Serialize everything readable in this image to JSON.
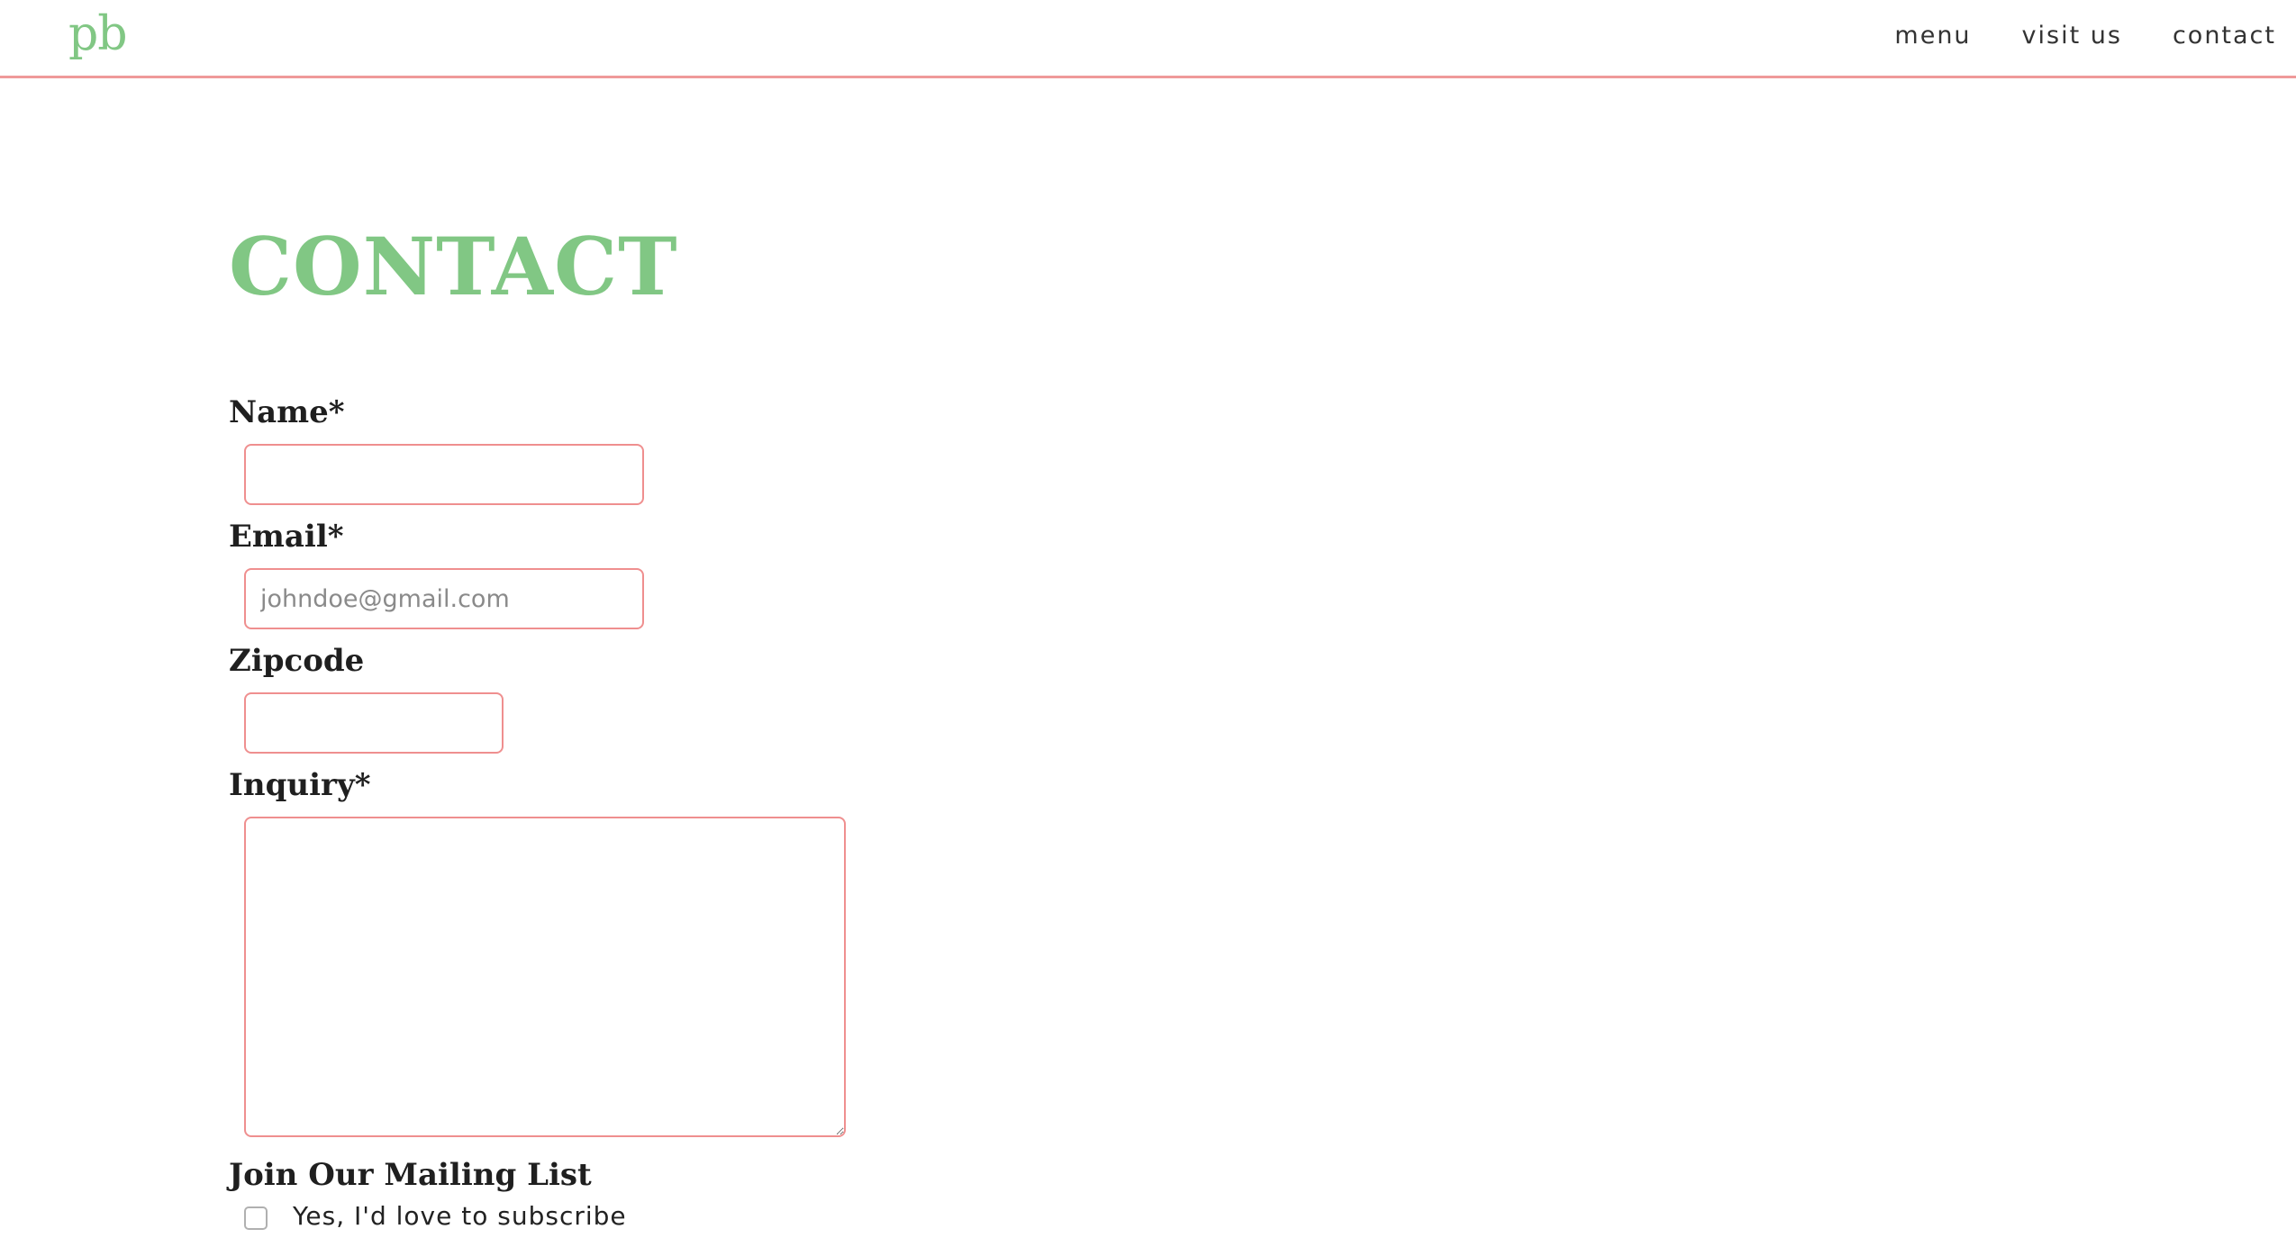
{
  "nav": {
    "logo": "pb",
    "links": [
      {
        "label": "menu"
      },
      {
        "label": "visit us"
      },
      {
        "label": "contact"
      }
    ]
  },
  "page": {
    "title": "CONTACT"
  },
  "form": {
    "name": {
      "label": "Name*",
      "value": "",
      "placeholder": ""
    },
    "email": {
      "label": "Email*",
      "value": "",
      "placeholder": "johndoe@gmail.com"
    },
    "zipcode": {
      "label": "Zipcode",
      "value": "",
      "placeholder": ""
    },
    "inquiry": {
      "label": "Inquiry*",
      "value": "",
      "placeholder": ""
    },
    "mailing_list": {
      "heading": "Join Our Mailing List",
      "checkbox_label": "Yes, I'd love to subscribe",
      "checked": false
    }
  },
  "colors": {
    "accent_green": "#81c784",
    "accent_pink": "#ef8f8f"
  }
}
